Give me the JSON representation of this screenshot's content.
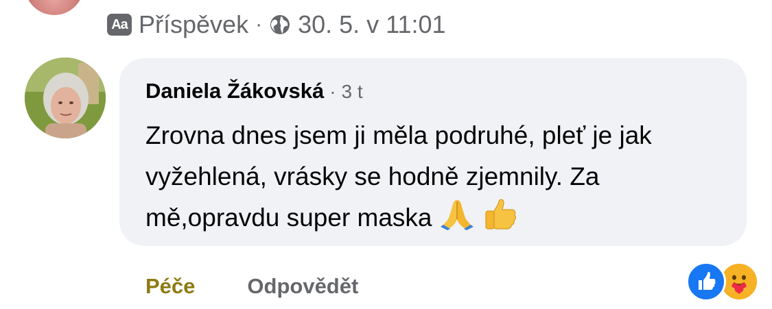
{
  "meta": {
    "aa_label": "Aa",
    "type_label": "Příspěvek",
    "separator": "·",
    "date": "30. 5. v 11:01"
  },
  "comment": {
    "author": "Daniela Žákovská",
    "time_separator": "·",
    "time": "3 t",
    "text": "Zrovna dnes jsem ji měla podruhé, pleť je jak vyžehlená, vrásky se hodně zjemnily. Za mě,opravdu super maska",
    "emojis": [
      "folded-hands-icon",
      "thumbs-up-icon"
    ]
  },
  "actions": {
    "like_label": "Péče",
    "reply_label": "Odpovědět"
  },
  "reactions": [
    "like-reaction-icon",
    "care-reaction-icon"
  ],
  "colors": {
    "bubble": "#f0f2f5",
    "meta_gray": "#65676b",
    "care_action": "#8d7a12",
    "like_blue": "#1877f2",
    "care_yellow": "#f7b125"
  }
}
